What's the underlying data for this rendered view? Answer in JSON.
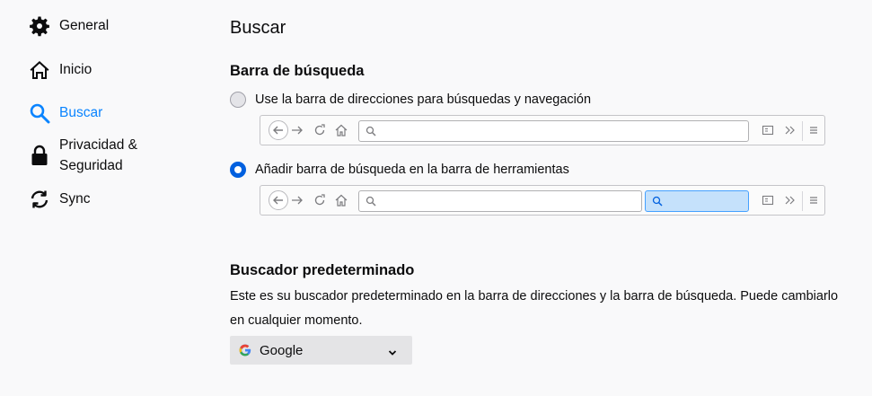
{
  "sidebar": {
    "items": [
      {
        "label": "General",
        "icon": "gear-icon",
        "active": false
      },
      {
        "label": "Inicio",
        "icon": "home-icon",
        "active": false
      },
      {
        "label": "Buscar",
        "icon": "search-icon",
        "active": true
      },
      {
        "label": "Privacidad &\nSeguridad",
        "icon": "lock-icon",
        "active": false
      },
      {
        "label": "Sync",
        "icon": "sync-icon",
        "active": false
      }
    ]
  },
  "main": {
    "title": "Buscar",
    "search_bar": {
      "heading": "Barra de búsqueda",
      "options": [
        {
          "label": "Use la barra de direcciones para búsquedas y navegación",
          "checked": false
        },
        {
          "label": "Añadir barra de búsqueda en la barra de herramientas",
          "checked": true
        }
      ]
    },
    "default_engine": {
      "heading": "Buscador predeterminado",
      "description": "Este es su buscador predeterminado en la barra de direcciones y la barra de búsqueda. Puede cambiarlo en cualquier momento.",
      "selected": "Google"
    }
  },
  "colors": {
    "accent": "#0a84ff",
    "radio_checked": "#0060df",
    "search_highlight": "#c5e1fb"
  }
}
